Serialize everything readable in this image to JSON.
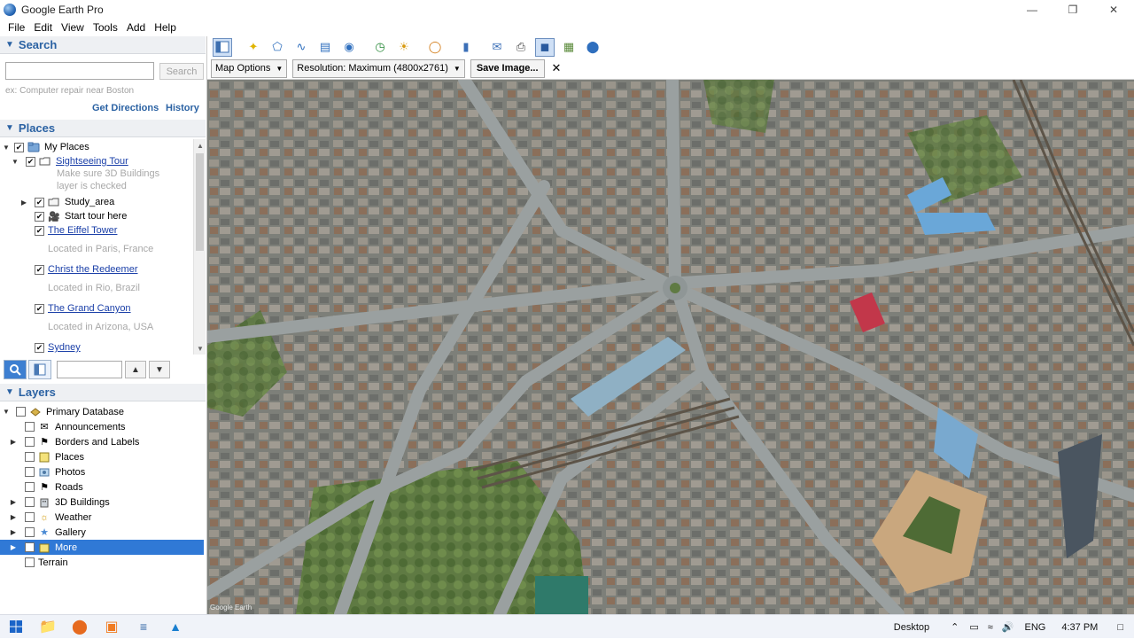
{
  "window": {
    "title": "Google Earth Pro"
  },
  "menu": [
    {
      "label": "File"
    },
    {
      "label": "Edit"
    },
    {
      "label": "View"
    },
    {
      "label": "Tools"
    },
    {
      "label": "Add"
    },
    {
      "label": "Help"
    }
  ],
  "search": {
    "header": "Search",
    "placeholder": "",
    "button": "Search",
    "hint": "ex: Computer repair near Boston",
    "get_directions": "Get Directions",
    "history": "History"
  },
  "places": {
    "header": "Places",
    "items": [
      {
        "label": "My Places",
        "desc": ""
      },
      {
        "label": "Sightseeing Tour",
        "desc": "Make sure 3D Buildings"
      },
      {
        "label": "",
        "desc": "layer is checked"
      },
      {
        "label": "Study_area",
        "desc": ""
      },
      {
        "label": "Start tour here",
        "desc": ""
      },
      {
        "label": "The Eiffel Tower",
        "desc": "Located in Paris, France"
      },
      {
        "label": "Christ the Redeemer",
        "desc": "Located in Rio, Brazil"
      },
      {
        "label": "The Grand Canyon",
        "desc": "Located in Arizona, USA"
      },
      {
        "label": "Sydney",
        "desc": ""
      }
    ]
  },
  "layers": {
    "header": "Layers",
    "items": [
      {
        "label": "Primary Database"
      },
      {
        "label": "Announcements"
      },
      {
        "label": "Borders and Labels"
      },
      {
        "label": "Places"
      },
      {
        "label": "Photos"
      },
      {
        "label": "Roads"
      },
      {
        "label": "3D Buildings"
      },
      {
        "label": "Weather"
      },
      {
        "label": "Gallery"
      },
      {
        "label": "More"
      },
      {
        "label": "Terrain"
      }
    ]
  },
  "savebar": {
    "map_options": "Map Options",
    "resolution": "Resolution: Maximum (4800x2761)",
    "save_image": "Save Image...",
    "close": "✕"
  },
  "taskbar": {
    "desktop": "Desktop",
    "language": "ENG",
    "time": "4:37 PM"
  },
  "colors": {
    "accent": "#2b62a3",
    "selection": "#3079d6",
    "link": "#1a3fa8"
  }
}
